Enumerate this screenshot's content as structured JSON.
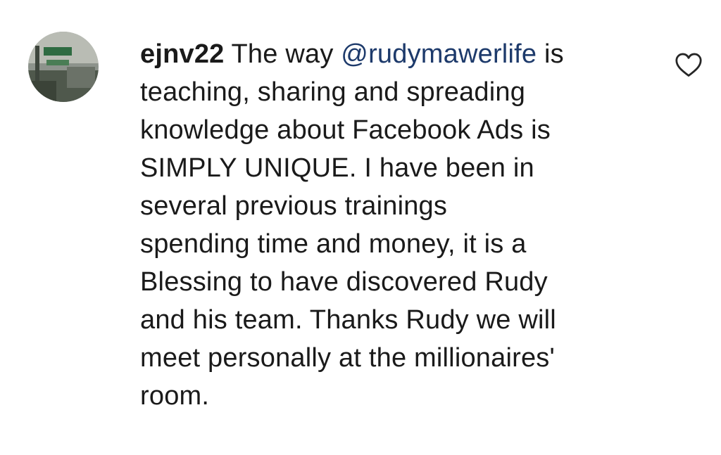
{
  "comment": {
    "username": "ejnv22",
    "first_line_prefix": "The way ",
    "mention": "@rudymawerlife",
    "first_line_suffix": " is",
    "lines": [
      "teaching, sharing and spreading",
      "knowledge about Facebook Ads is",
      "SIMPLY UNIQUE. I have been in",
      "several previous trainings",
      "spending time and money, it is a",
      "Blessing to have discovered Rudy",
      "and his team. Thanks Rudy we will",
      "meet personally at the millionaires'",
      "room."
    ]
  },
  "icons": {
    "avatar": "profile-photo",
    "like": "heart-outline-icon"
  },
  "colors": {
    "text": "#1a1a1a",
    "mention": "#1d3a6b",
    "icon": "#262626"
  }
}
